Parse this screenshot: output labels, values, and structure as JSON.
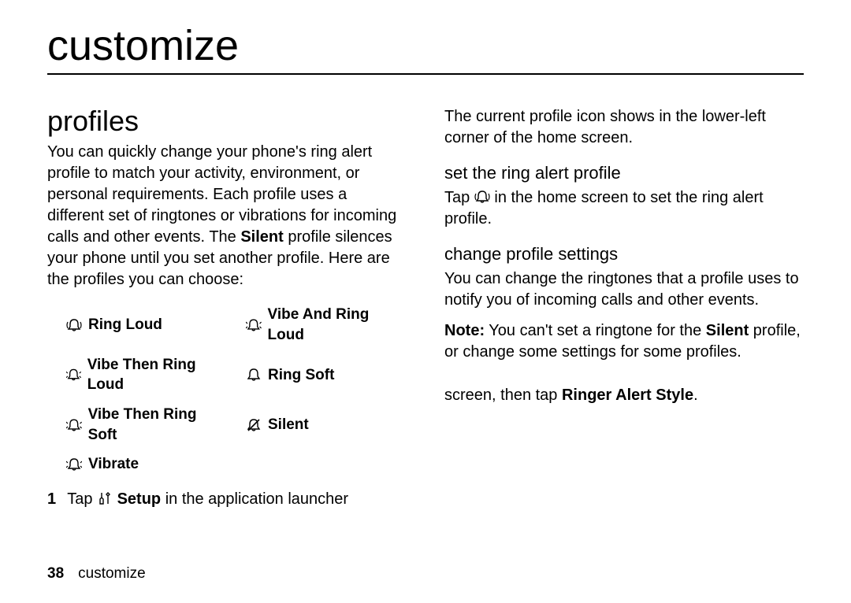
{
  "chapter": "customize",
  "left": {
    "section_title": "profiles",
    "intro_pre": "You can quickly change your phone's ring alert profile to match your activity, environment, or personal requirements. Each profile uses a different set of ringtones or vibrations for incoming calls and other events. The ",
    "intro_silent": "Silent",
    "intro_post": " profile silences your phone until you set another profile. Here are the profiles you can choose:",
    "col1": [
      {
        "icon": "ring-loud-icon",
        "label": "Ring Loud"
      },
      {
        "icon": "vibe-then-ring-loud-icon",
        "label": "Vibe Then Ring Loud"
      },
      {
        "icon": "vibe-then-ring-soft-icon",
        "label": "Vibe Then Ring Soft"
      },
      {
        "icon": "vibrate-icon",
        "label": "Vibrate"
      }
    ],
    "col2": [
      {
        "icon": "vibe-and-ring-loud-icon",
        "label": "Vibe And Ring Loud"
      },
      {
        "icon": "ring-soft-icon",
        "label": "Ring Soft"
      },
      {
        "icon": "silent-icon",
        "label": "Silent"
      }
    ],
    "step_num": "1",
    "step_pre": "Tap ",
    "step_setup": "Setup",
    "step_post": " in the application launcher"
  },
  "right": {
    "top_para": "The current profile icon shows in the lower-left corner of the home screen.",
    "sub1": "set the ring alert profile",
    "sub1_pre": "Tap ",
    "sub1_post": " in the home screen to set the ring alert profile.",
    "sub2": "change profile settings",
    "sub2_para": "You can change the ringtones that a profile uses to notify you of incoming calls and other events.",
    "note_label": "Note:",
    "note_pre": " You can't set a ringtone for the ",
    "note_silent": "Silent",
    "note_post": " profile, or change some settings for some profiles.",
    "bottom_pre": "screen, then tap ",
    "bottom_bold": "Ringer Alert Style",
    "bottom_post": "."
  },
  "footer": {
    "page": "38",
    "section": "customize"
  }
}
